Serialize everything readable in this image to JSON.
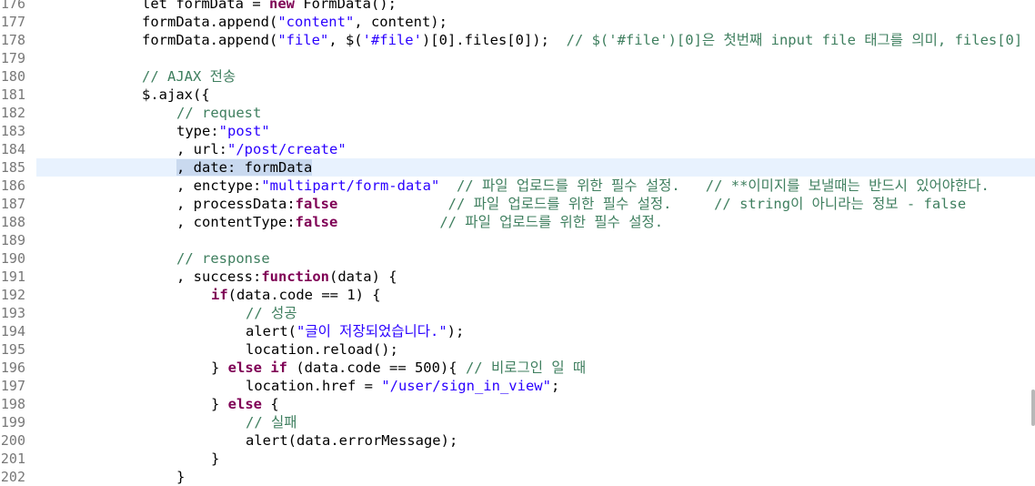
{
  "editor": {
    "current_line": "185",
    "lines": [
      {
        "num": "176",
        "indent": 1,
        "tokens": [
          {
            "t": "",
            "v": "let formData = "
          },
          {
            "t": "k",
            "v": "new"
          },
          {
            "t": "",
            "v": " FormData();"
          }
        ]
      },
      {
        "num": "177",
        "indent": 1,
        "tokens": [
          {
            "t": "",
            "v": "formData.append("
          },
          {
            "t": "s",
            "v": "\"content\""
          },
          {
            "t": "",
            "v": ", content);"
          }
        ]
      },
      {
        "num": "178",
        "indent": 1,
        "tokens": [
          {
            "t": "",
            "v": "formData.append("
          },
          {
            "t": "s",
            "v": "\"file\""
          },
          {
            "t": "",
            "v": ", $("
          },
          {
            "t": "s",
            "v": "'#file'"
          },
          {
            "t": "",
            "v": ")[0].files[0]);  "
          },
          {
            "t": "c",
            "v": "// $('#file')[0]은 첫번째 input file 태그를 의미, files[0]"
          }
        ]
      },
      {
        "num": "179",
        "indent": 0,
        "tokens": []
      },
      {
        "num": "180",
        "indent": 1,
        "tokens": [
          {
            "t": "c",
            "v": "// AJAX 전송"
          }
        ]
      },
      {
        "num": "181",
        "indent": 1,
        "tokens": [
          {
            "t": "",
            "v": "$.ajax({"
          }
        ]
      },
      {
        "num": "182",
        "indent": 2,
        "tokens": [
          {
            "t": "c",
            "v": "// request"
          }
        ]
      },
      {
        "num": "183",
        "indent": 2,
        "tokens": [
          {
            "t": "",
            "v": "type:"
          },
          {
            "t": "s",
            "v": "\"post\""
          }
        ]
      },
      {
        "num": "184",
        "indent": 2,
        "tokens": [
          {
            "t": "",
            "v": ", url:"
          },
          {
            "t": "s",
            "v": "\"/post/create\""
          }
        ]
      },
      {
        "num": "185",
        "indent": 2,
        "tokens": [
          {
            "t": "sel",
            "v": ", date: formData"
          }
        ]
      },
      {
        "num": "186",
        "indent": 2,
        "tokens": [
          {
            "t": "",
            "v": ", enctype:"
          },
          {
            "t": "s",
            "v": "\"multipart/form-data\""
          },
          {
            "t": "",
            "v": "  "
          },
          {
            "t": "c",
            "v": "// 파일 업로드를 위한 필수 설정.   // **이미지를 보낼때는 반드시 있어야한다."
          }
        ]
      },
      {
        "num": "187",
        "indent": 2,
        "tokens": [
          {
            "t": "",
            "v": ", processData:"
          },
          {
            "t": "k",
            "v": "false"
          },
          {
            "t": "",
            "v": "             "
          },
          {
            "t": "c",
            "v": "// 파일 업로드를 위한 필수 설정.     // string이 아니라는 정보 - false"
          }
        ]
      },
      {
        "num": "188",
        "indent": 2,
        "tokens": [
          {
            "t": "",
            "v": ", contentType:"
          },
          {
            "t": "k",
            "v": "false"
          },
          {
            "t": "",
            "v": "            "
          },
          {
            "t": "c",
            "v": "// 파일 업로드를 위한 필수 설정."
          }
        ]
      },
      {
        "num": "189",
        "indent": 0,
        "tokens": []
      },
      {
        "num": "190",
        "indent": 2,
        "tokens": [
          {
            "t": "c",
            "v": "// response"
          }
        ]
      },
      {
        "num": "191",
        "indent": 2,
        "tokens": [
          {
            "t": "",
            "v": ", success:"
          },
          {
            "t": "k",
            "v": "function"
          },
          {
            "t": "",
            "v": "(data) {"
          }
        ]
      },
      {
        "num": "192",
        "indent": 3,
        "tokens": [
          {
            "t": "k",
            "v": "if"
          },
          {
            "t": "",
            "v": "(data.code == 1) {"
          }
        ]
      },
      {
        "num": "193",
        "indent": 4,
        "tokens": [
          {
            "t": "c",
            "v": "// 성공"
          }
        ]
      },
      {
        "num": "194",
        "indent": 4,
        "tokens": [
          {
            "t": "",
            "v": "alert("
          },
          {
            "t": "s",
            "v": "\"글이 저장되었습니다.\""
          },
          {
            "t": "",
            "v": ");"
          }
        ]
      },
      {
        "num": "195",
        "indent": 4,
        "tokens": [
          {
            "t": "",
            "v": "location.reload();"
          }
        ]
      },
      {
        "num": "196",
        "indent": 3,
        "tokens": [
          {
            "t": "",
            "v": "} "
          },
          {
            "t": "k",
            "v": "else if"
          },
          {
            "t": "",
            "v": " (data.code == 500){ "
          },
          {
            "t": "c",
            "v": "// 비로그인 일 때"
          }
        ]
      },
      {
        "num": "197",
        "indent": 4,
        "tokens": [
          {
            "t": "",
            "v": "location.href = "
          },
          {
            "t": "s",
            "v": "\"/user/sign_in_view\""
          },
          {
            "t": "",
            "v": ";"
          }
        ]
      },
      {
        "num": "198",
        "indent": 3,
        "tokens": [
          {
            "t": "",
            "v": "} "
          },
          {
            "t": "k",
            "v": "else"
          },
          {
            "t": "",
            "v": " {"
          }
        ]
      },
      {
        "num": "199",
        "indent": 4,
        "tokens": [
          {
            "t": "c",
            "v": "// 실패"
          }
        ]
      },
      {
        "num": "200",
        "indent": 4,
        "tokens": [
          {
            "t": "",
            "v": "alert(data.errorMessage);"
          }
        ]
      },
      {
        "num": "201",
        "indent": 3,
        "tokens": [
          {
            "t": "",
            "v": "}"
          }
        ]
      },
      {
        "num": "202",
        "indent": 2,
        "tokens": [
          {
            "t": "",
            "v": "}"
          }
        ]
      }
    ]
  },
  "colors": {
    "keyword": "#7f0055",
    "string": "#2a00ff",
    "comment": "#3f7f5f",
    "current_line_bg": "#e8f2fe",
    "selection_bg": "#c9d9ef",
    "line_number": "#787878"
  }
}
